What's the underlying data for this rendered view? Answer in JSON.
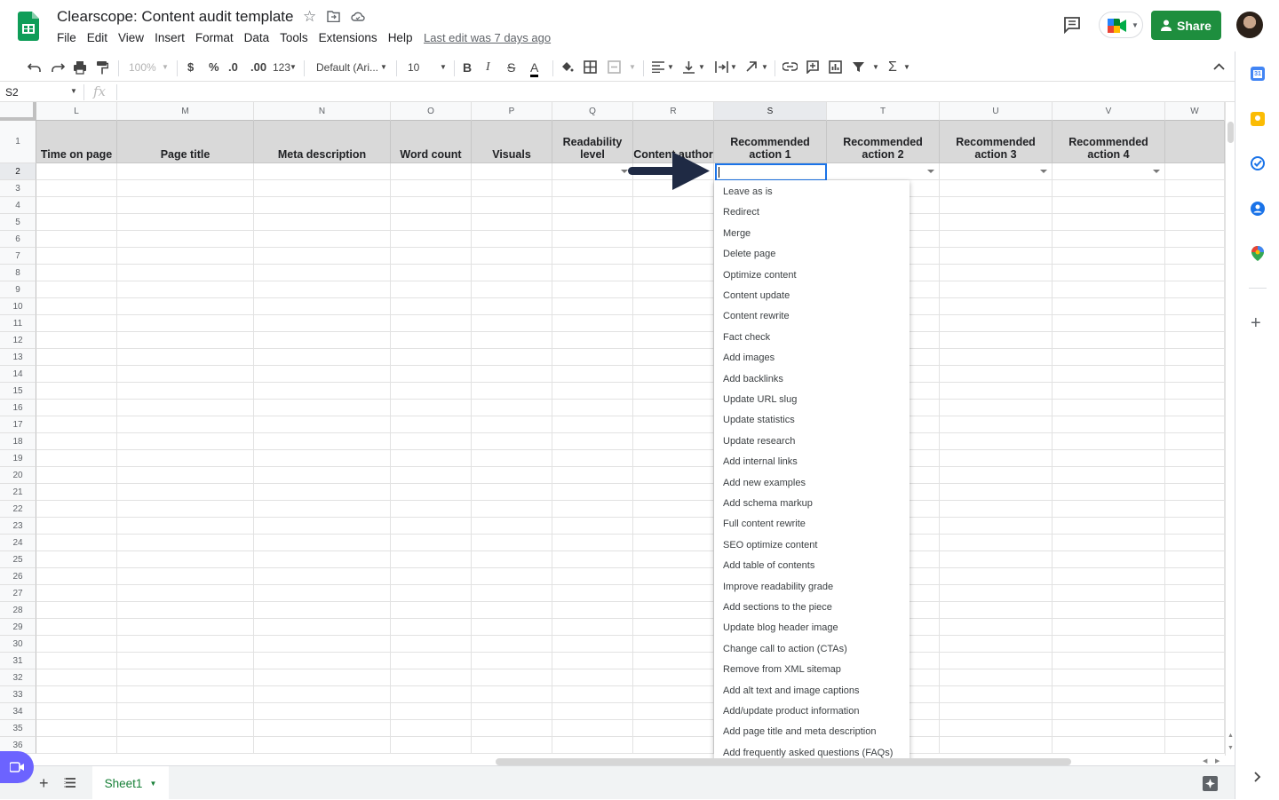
{
  "document": {
    "title": "Clearscope: Content audit template",
    "last_edit": "Last edit was 7 days ago"
  },
  "menu": [
    "File",
    "Edit",
    "View",
    "Insert",
    "Format",
    "Data",
    "Tools",
    "Extensions",
    "Help"
  ],
  "share_label": "Share",
  "toolbar": {
    "zoom": "100%",
    "currency": "$",
    "percent": "%",
    "dec_decrease": ".0",
    "dec_increase": ".00",
    "more_formats": "123",
    "font": "Default (Ari...",
    "font_size": "10"
  },
  "formula_bar": {
    "name_box": "S2",
    "fx": "fx"
  },
  "columns": [
    {
      "letter": "L",
      "header": "Time on page"
    },
    {
      "letter": "M",
      "header": "Page title"
    },
    {
      "letter": "N",
      "header": "Meta description"
    },
    {
      "letter": "O",
      "header": "Word count"
    },
    {
      "letter": "P",
      "header": "Visuals"
    },
    {
      "letter": "Q",
      "header": "Readability level"
    },
    {
      "letter": "R",
      "header": "Content author"
    },
    {
      "letter": "S",
      "header": "Recommended action 1"
    },
    {
      "letter": "T",
      "header": "Recommended action 2"
    },
    {
      "letter": "U",
      "header": "Recommended action 3"
    },
    {
      "letter": "V",
      "header": "Recommended action 4"
    },
    {
      "letter": "W",
      "header": ""
    }
  ],
  "rows": [
    "1",
    "2",
    "3",
    "4",
    "5",
    "6",
    "7",
    "8",
    "9",
    "10",
    "11",
    "12",
    "13",
    "14",
    "15",
    "16",
    "17",
    "18",
    "19",
    "20",
    "21",
    "22",
    "23",
    "24",
    "25",
    "26",
    "27",
    "28",
    "29",
    "30",
    "31",
    "32",
    "33",
    "34",
    "35",
    "36"
  ],
  "dropdown_options": [
    "Leave as is",
    "Redirect",
    "Merge",
    "Delete page",
    "Optimize content",
    "Content update",
    "Content rewrite",
    "Fact check",
    "Add images",
    "Add backlinks",
    "Update URL slug",
    "Update statistics",
    "Update research",
    "Add internal links",
    "Add new examples",
    "Add schema markup",
    "Full content rewrite",
    "SEO optimize content",
    "Add table of contents",
    "Improve readability grade",
    "Add sections to the piece",
    "Update blog header image",
    "Change call to action (CTAs)",
    "Remove from XML sitemap",
    "Add alt text and image captions",
    "Add/update product information",
    "Add page title and meta description",
    "Add frequently asked questions (FAQs)"
  ],
  "sheet_tab": "Sheet1",
  "colors": {
    "share": "#1e8e3e",
    "header_fill": "#d9d9d9",
    "selection": "#1a73e8",
    "arrow": "#1f2a44"
  }
}
